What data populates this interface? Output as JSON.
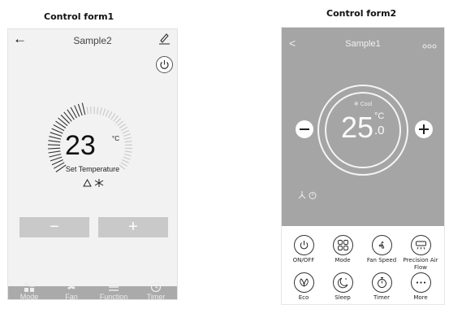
{
  "captions": {
    "form1": "Control form1",
    "form2": "Control form2"
  },
  "form1": {
    "title": "Sample2",
    "temperature": "23",
    "unit": "°C",
    "label": "Set Temperature",
    "minus": "−",
    "plus": "+",
    "nav": [
      {
        "label": "Mode",
        "icon": "mode-icon"
      },
      {
        "label": "Fan",
        "icon": "fan-icon"
      },
      {
        "label": "Function",
        "icon": "menu-icon"
      },
      {
        "label": "Timer",
        "icon": "clock-icon"
      }
    ],
    "colors": {
      "panel": "#f2f2f2",
      "button": "#c9c9c9",
      "nav": "#aaaaaa"
    }
  },
  "form2": {
    "title": "Sample1",
    "back": "<",
    "mode": "Cool",
    "temperature": "25",
    "unit": "°C",
    "decimal": ".0",
    "functions": [
      {
        "label": "ON/OFF",
        "icon": "power-icon"
      },
      {
        "label": "Mode",
        "icon": "mode-icon"
      },
      {
        "label": "Fan Speed",
        "icon": "fan-icon"
      },
      {
        "label": "Precision Air Flow",
        "icon": "air-flow-icon"
      },
      {
        "label": "Eco",
        "icon": "leaf-icon"
      },
      {
        "label": "Sleep",
        "icon": "moon-icon"
      },
      {
        "label": "Timer",
        "icon": "stopwatch-icon"
      },
      {
        "label": "More",
        "icon": "more-icon"
      }
    ],
    "colors": {
      "top": "#a5a5a5"
    }
  }
}
